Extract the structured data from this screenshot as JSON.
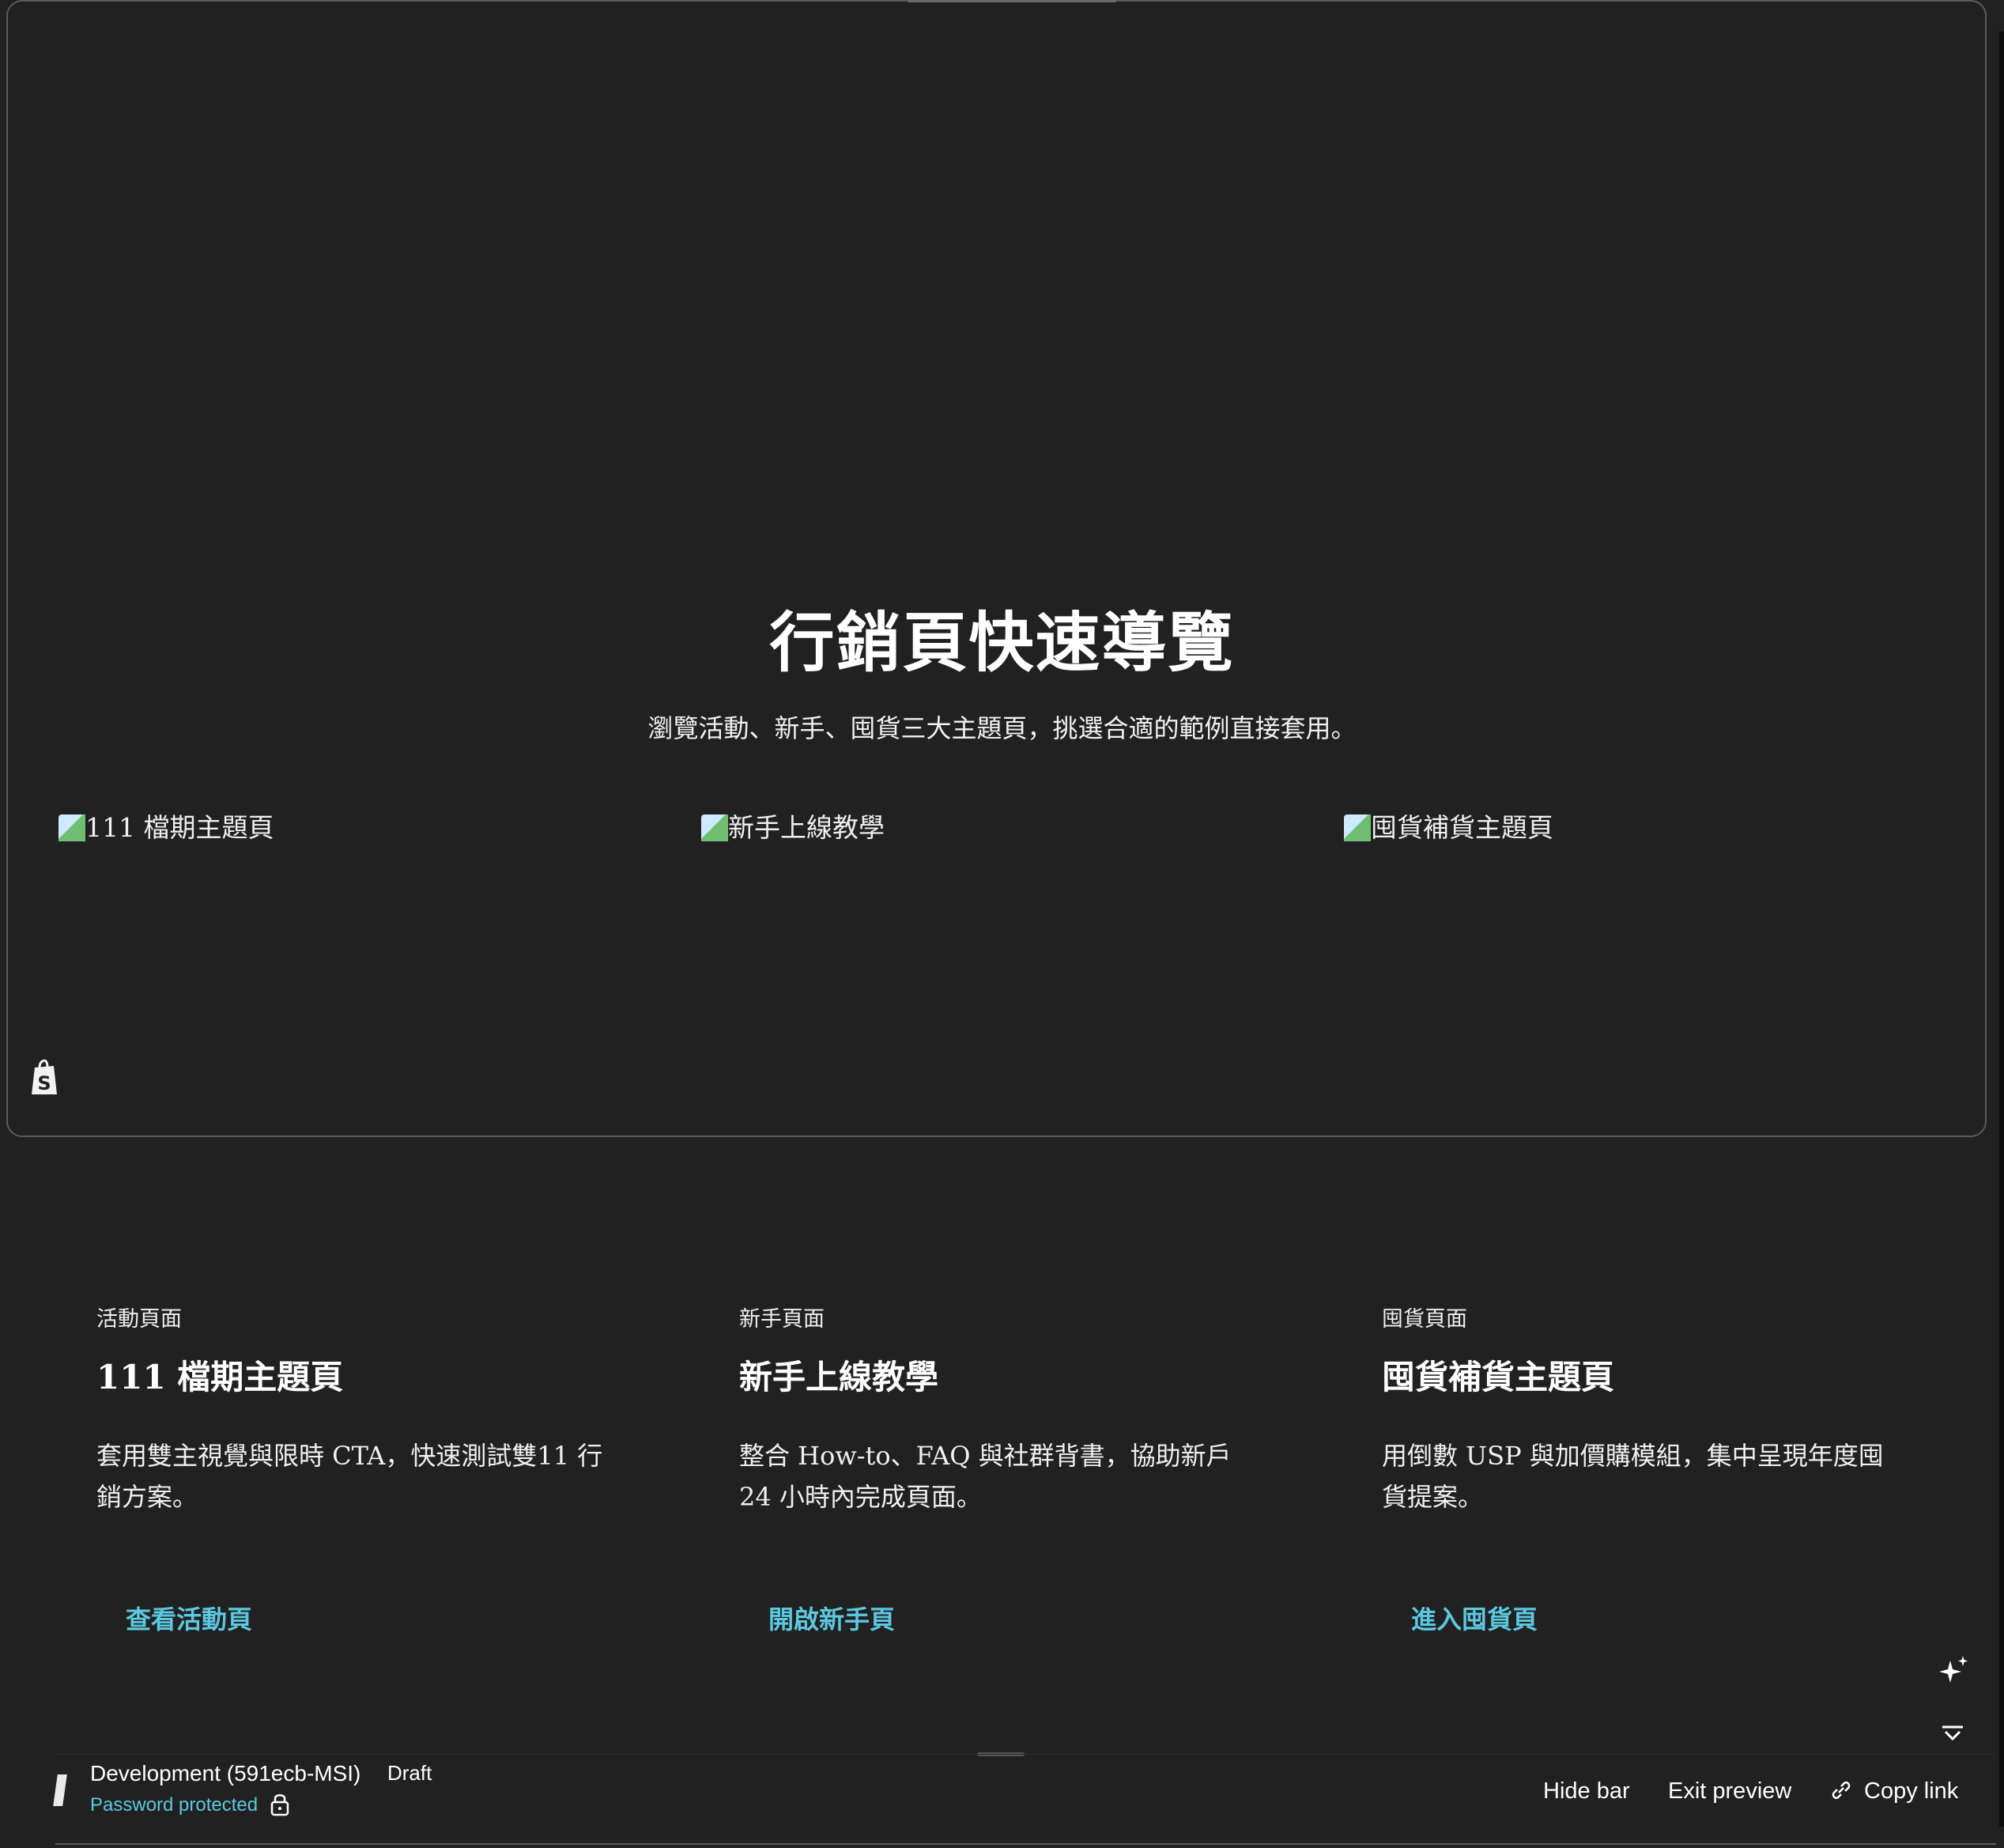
{
  "hero": {
    "title": "行銷頁快速導覽",
    "subtitle": "瀏覽活動、新手、囤貨三大主題頁，挑選合適的範例直接套用。"
  },
  "cards": [
    {
      "image_alt": "111 檔期主題頁",
      "category": "活動頁面",
      "title": "111 檔期主題頁",
      "description": "套用雙主視覺與限時 CTA，快速測試雙11 行銷方案。",
      "link": "查看活動頁"
    },
    {
      "image_alt": "新手上線教學",
      "category": "新手頁面",
      "title": "新手上線教學",
      "description": "整合 How-to、FAQ 與社群背書，協助新戶 24 小時內完成頁面。",
      "link": "開啟新手頁"
    },
    {
      "image_alt": "囤貨補貨主題頁",
      "category": "囤貨頁面",
      "title": "囤貨補貨主題頁",
      "description": "用倒數 USP 與加價購模組，集中呈現年度囤貨提案。",
      "link": "進入囤貨頁"
    }
  ],
  "preview_bar": {
    "store_name": "Development (591ecb-MSI)",
    "status": "Draft",
    "password": "Password protected",
    "hide_bar": "Hide bar",
    "exit_preview": "Exit preview",
    "copy_link": "Copy link"
  },
  "icons": {
    "shopify": "shopify-bag-icon",
    "sparkle": "sparkle-icon",
    "collapse": "collapse-icon",
    "lock": "lock-icon",
    "link": "link-icon",
    "broken_image": "broken-image-icon"
  },
  "colors": {
    "background": "#212121",
    "accent": "#5cc8e0",
    "text": "#ffffff"
  }
}
